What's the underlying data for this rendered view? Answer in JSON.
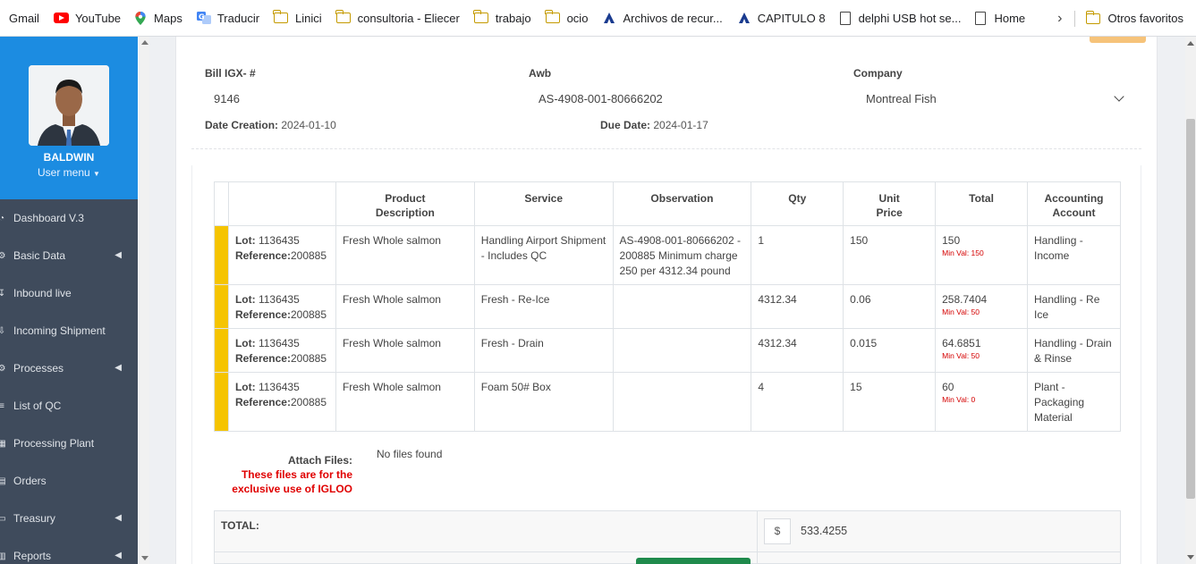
{
  "bookmarks": [
    {
      "label": "Gmail",
      "icon": "gmail-icon"
    },
    {
      "label": "YouTube",
      "icon": "youtube-icon"
    },
    {
      "label": "Maps",
      "icon": "maps-pin-icon"
    },
    {
      "label": "Traducir",
      "icon": "translate-icon"
    },
    {
      "label": "Linici",
      "icon": "folder-icon"
    },
    {
      "label": "consultoria - Eliecer",
      "icon": "folder-icon"
    },
    {
      "label": "trabajo",
      "icon": "folder-icon"
    },
    {
      "label": "ocio",
      "icon": "folder-icon"
    },
    {
      "label": "Archivos de recur...",
      "icon": "site-icon"
    },
    {
      "label": "CAPITULO 8",
      "icon": "site-icon"
    },
    {
      "label": "delphi USB hot se...",
      "icon": "document-icon"
    },
    {
      "label": "Home",
      "icon": "document-icon"
    }
  ],
  "other_bookmarks": "Otros favoritos",
  "user": {
    "name": "BALDWIN",
    "menu": "User menu"
  },
  "sidebar": {
    "items": [
      {
        "label": "Dashboard V.3",
        "icon": "dashboard-icon",
        "has_arrow": false
      },
      {
        "label": "Basic Data",
        "icon": "data-icon",
        "has_arrow": true
      },
      {
        "label": "Inbound live",
        "icon": "inbound-icon",
        "has_arrow": false
      },
      {
        "label": "Incoming Shipment",
        "icon": "shipment-icon",
        "has_arrow": false
      },
      {
        "label": "Processes",
        "icon": "process-icon",
        "has_arrow": true
      },
      {
        "label": "List of QC",
        "icon": "list-icon",
        "has_arrow": false
      },
      {
        "label": "Processing Plant",
        "icon": "plant-icon",
        "has_arrow": false
      },
      {
        "label": "Orders",
        "icon": "orders-icon",
        "has_arrow": false
      },
      {
        "label": "Treasury",
        "icon": "treasury-icon",
        "has_arrow": true
      },
      {
        "label": "Reports",
        "icon": "reports-icon",
        "has_arrow": true
      }
    ]
  },
  "bill": {
    "bill_label": "Bill IGX- #",
    "bill_value": "9146",
    "awb_label": "Awb",
    "awb_value": "AS-4908-001-80666202",
    "company_label": "Company",
    "company_value": "Montreal Fish",
    "date_creation_label": "Date Creation:",
    "date_creation_value": "2024-01-10",
    "due_date_label": "Due Date:",
    "due_date_value": "2024-01-17"
  },
  "table": {
    "headers": [
      "Product Description",
      "Service",
      "Observation",
      "Qty",
      "Unit Price",
      "Total",
      "Accounting Account"
    ],
    "rows": [
      {
        "lot_label": "Lot:",
        "lot": "1136435",
        "ref_label": "Reference:",
        "ref": "200885",
        "product": "Fresh Whole salmon",
        "service": "Handling Airport Shipment - Includes QC",
        "observation": "AS-4908-001-80666202 - 200885 Minimum charge 250 per 4312.34 pound",
        "qty": "1",
        "unit_price": "150",
        "total": "150",
        "min_val": "Min Val: 150",
        "account": "Handling - Income"
      },
      {
        "lot_label": "Lot:",
        "lot": "1136435",
        "ref_label": "Reference:",
        "ref": "200885",
        "product": "Fresh Whole salmon",
        "service": "Fresh - Re-Ice",
        "observation": "",
        "qty": "4312.34",
        "unit_price": "0.06",
        "total": "258.7404",
        "min_val": "Min Val: 50",
        "account": "Handling - Re Ice"
      },
      {
        "lot_label": "Lot:",
        "lot": "1136435",
        "ref_label": "Reference:",
        "ref": "200885",
        "product": "Fresh Whole salmon",
        "service": "Fresh - Drain",
        "observation": "",
        "qty": "4312.34",
        "unit_price": "0.015",
        "total": "64.6851",
        "min_val": "Min Val: 50",
        "account": "Handling - Drain & Rinse"
      },
      {
        "lot_label": "Lot:",
        "lot": "1136435",
        "ref_label": "Reference:",
        "ref": "200885",
        "product": "Fresh Whole salmon",
        "service": "Foam 50# Box",
        "observation": "",
        "qty": "4",
        "unit_price": "15",
        "total": "60",
        "min_val": "Min Val: 0",
        "account": "Plant - Packaging Material"
      }
    ]
  },
  "attach": {
    "label": "Attach Files:",
    "note": "These files are for the exclusive use of IGLOO",
    "no_files": "No files found"
  },
  "total": {
    "label": "TOTAL:",
    "currency": "$",
    "value": "533.4255"
  },
  "colors": {
    "sidebar": "#3f4b5c",
    "user_panel": "#1c8ce1",
    "row_stripe": "#f5c400",
    "min_val": "#d40000",
    "note": "#e00000"
  }
}
